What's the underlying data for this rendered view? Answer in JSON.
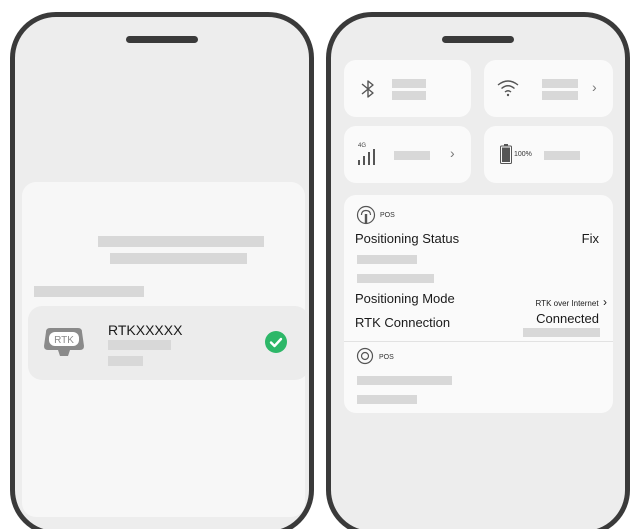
{
  "left_phone": {
    "device": {
      "badge_label": "RTK",
      "name": "RTKXXXXX"
    }
  },
  "right_phone": {
    "tiles": {
      "cellular_label": "4G",
      "battery_text": "100%"
    },
    "pos_card": {
      "section1_title": "POS",
      "positioning_status_label": "Positioning Status",
      "positioning_status_value": "Fix",
      "positioning_mode_label": "Positioning Mode",
      "positioning_mode_value": "RTK over Internet",
      "rtk_connection_label": "RTK Connection",
      "rtk_connection_value": "Connected",
      "section2_title": "POS"
    }
  },
  "icons": [
    "bluetooth-icon",
    "wifi-icon",
    "cellular-signal-icon",
    "battery-icon",
    "antenna-icon",
    "location-pin-icon",
    "checkmark-icon",
    "chevron-right-icon"
  ],
  "colors": {
    "check_green": "#2db768",
    "frame": "#3a3a3a",
    "screen_bg": "#ededed"
  }
}
